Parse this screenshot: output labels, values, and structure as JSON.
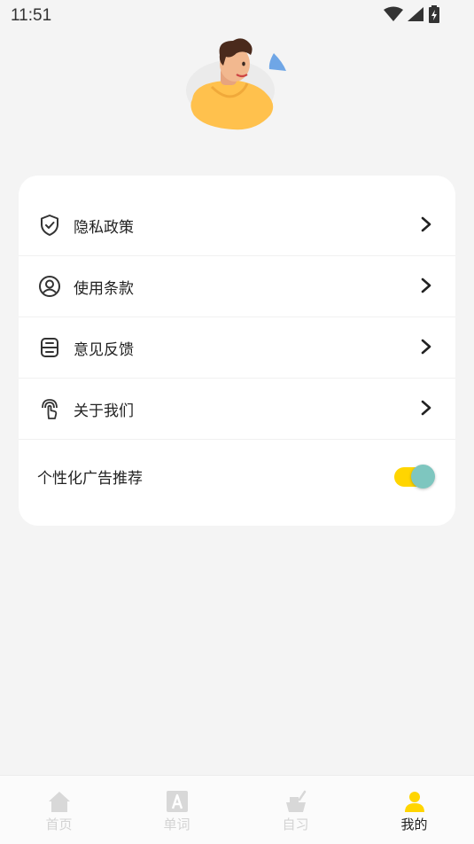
{
  "status_bar": {
    "time": "11:51"
  },
  "menu": {
    "items": [
      {
        "label": "隐私政策",
        "icon": "shield-check-icon"
      },
      {
        "label": "使用条款",
        "icon": "user-circle-icon"
      },
      {
        "label": "意见反馈",
        "icon": "feedback-box-icon"
      },
      {
        "label": "关于我们",
        "icon": "touch-hand-icon"
      }
    ],
    "ad_setting": {
      "label": "个性化广告推荐",
      "enabled": true
    }
  },
  "tabs": [
    {
      "label": "首页",
      "icon": "home-icon",
      "active": false
    },
    {
      "label": "单词",
      "icon": "letter-a-icon",
      "active": false
    },
    {
      "label": "自习",
      "icon": "study-desk-icon",
      "active": false
    },
    {
      "label": "我的",
      "icon": "person-icon",
      "active": true
    }
  ],
  "colors": {
    "accent": "#ffd500",
    "toggle_knob": "#7ec6bf",
    "background": "#f4f4f4",
    "card": "#ffffff"
  }
}
